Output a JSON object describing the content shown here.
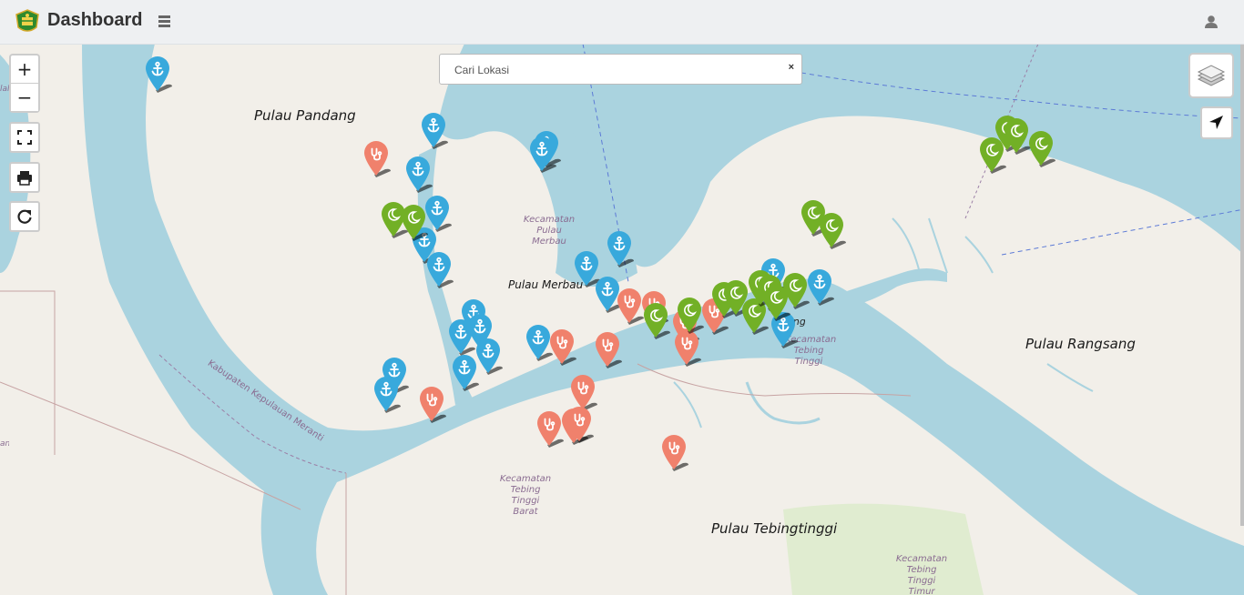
{
  "app": {
    "title": "Dashboard",
    "accent": "#3e9d3a"
  },
  "icons": {
    "menu": "hamburger-menu-icon",
    "user": "user-icon",
    "layers": "layers-icon",
    "locate": "location-arrow-icon",
    "fullscreen": "fullscreen-icon",
    "print": "printer-icon",
    "refresh": "refresh-icon"
  },
  "controls": {
    "zoom_in": "+",
    "zoom_out": "−",
    "search_placeholder": "Cari Lokasi",
    "search_value": "",
    "search_clear": "×"
  },
  "map": {
    "place_labels": [
      "Pulau Pandang",
      "Pulau Merbau",
      "Pulau Rangsang",
      "Pulau Tebingtinggi"
    ],
    "district_labels": [
      "Kecamatan Pulau Merbau",
      "Kecamatan Tebing Tinggi Barat",
      "Kecamatan Tebing Tinggi",
      "Kecamatan Tebing Tinggi Timur"
    ],
    "boundary_label": "Kabupaten Kepulauan Meranti",
    "partial_labels": [
      "lalis",
      "an",
      "ilang"
    ],
    "marker_colors": {
      "harbor": "#38a9dc",
      "health": "#f0816c",
      "mosque": "#72b026"
    },
    "marker_types": [
      "harbor",
      "health",
      "mosque"
    ],
    "marker_icons": {
      "harbor": "anchor-icon",
      "health": "stethoscope-icon",
      "mosque": "crescent-moon-icon"
    }
  }
}
